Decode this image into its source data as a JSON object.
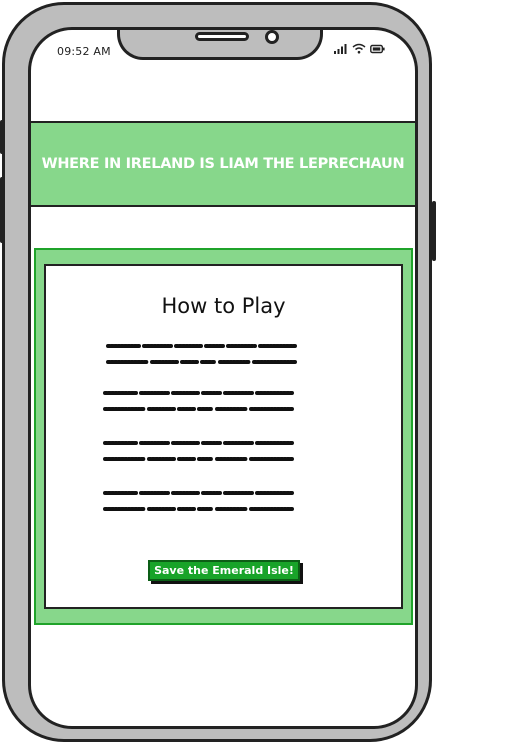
{
  "status_bar": {
    "time": "09:52 AM"
  },
  "header": {
    "title": "WHERE IN IRELAND IS LIAM THE LEPRECHAUN"
  },
  "how_to_play": {
    "title": "How to Play",
    "button_label": "Save the Emerald Isle!"
  },
  "colors": {
    "accent_green": "#87d78b",
    "button_green": "#18a329",
    "outline": "#222222"
  }
}
